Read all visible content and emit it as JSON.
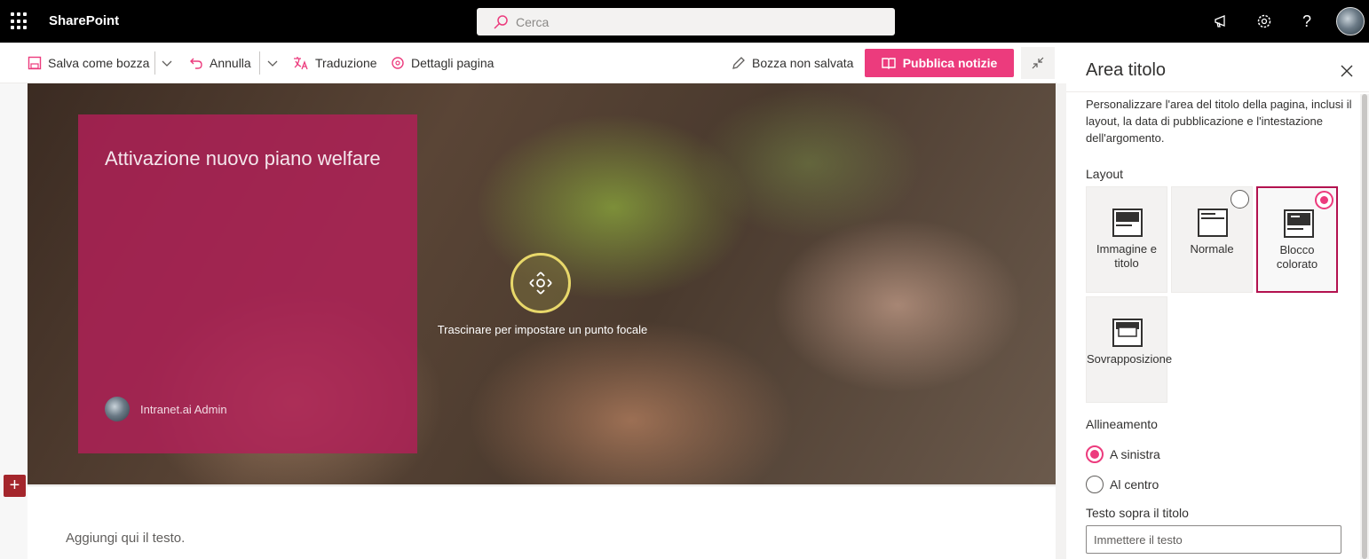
{
  "suite": {
    "app_name": "SharePoint",
    "search_placeholder": "Cerca",
    "icons": [
      "waffle-icon",
      "megaphone-icon",
      "settings-icon",
      "help-icon",
      "avatar"
    ]
  },
  "toolbar": {
    "save_draft": "Salva come bozza",
    "undo": "Annulla",
    "translation": "Traduzione",
    "page_details": "Dettagli pagina",
    "draft_status": "Bozza non salvata",
    "publish": "Pubblica notizie"
  },
  "hero": {
    "title": "Attivazione nuovo piano welfare",
    "author": "Intranet.ai Admin",
    "focal_hint": "Trascinare per impostare un punto focale"
  },
  "canvas": {
    "text_placeholder": "Aggiungi qui il testo."
  },
  "pane": {
    "title": "Area titolo",
    "description": "Personalizzare l'area del titolo della pagina, inclusi il layout, la data di pubblicazione e l'intestazione dell'argomento.",
    "layout_label": "Layout",
    "layouts": [
      {
        "label": "Immagine e titolo",
        "selected": false
      },
      {
        "label": "Normale",
        "selected": false
      },
      {
        "label": "Blocco colorato",
        "selected": true
      },
      {
        "label": "Sovrapposizione",
        "selected": false
      }
    ],
    "alignment_label": "Allineamento",
    "alignment_options": [
      {
        "label": "A sinistra",
        "selected": true
      },
      {
        "label": "Al centro",
        "selected": false
      }
    ],
    "topic_label": "Testo sopra il titolo",
    "topic_placeholder": "Immettere il testo"
  },
  "colors": {
    "accent": "#ec3b7d",
    "title_block": "#b22058",
    "suite_bar": "#000000"
  }
}
